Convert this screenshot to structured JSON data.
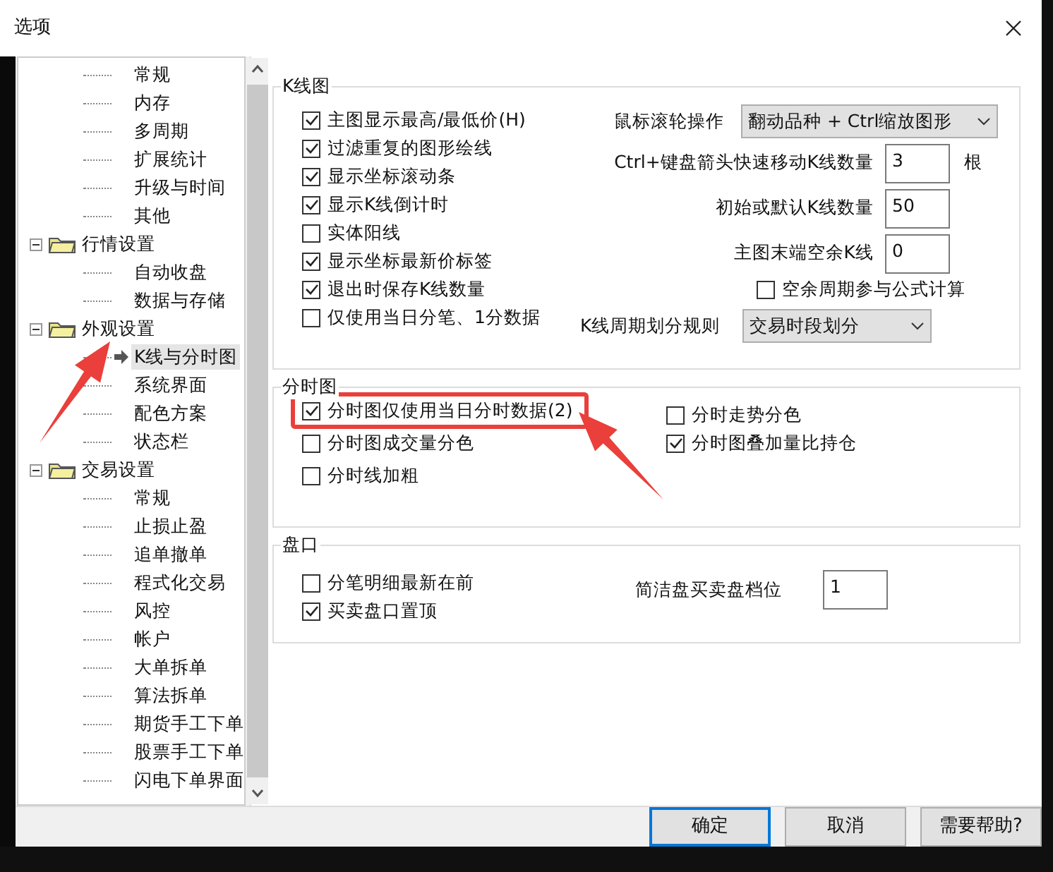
{
  "window": {
    "title": "选项"
  },
  "tree": {
    "partial_children": [
      {
        "label": "常规",
        "selected": false
      },
      {
        "label": "内存",
        "selected": false
      },
      {
        "label": "多周期",
        "selected": false
      },
      {
        "label": "扩展统计",
        "selected": false
      },
      {
        "label": "升级与时间",
        "selected": false
      },
      {
        "label": "其他",
        "selected": false
      }
    ],
    "groups": [
      {
        "label": "行情设置",
        "expanded": true,
        "children": [
          {
            "label": "自动收盘",
            "selected": false
          },
          {
            "label": "数据与存储",
            "selected": false
          }
        ]
      },
      {
        "label": "外观设置",
        "expanded": true,
        "children": [
          {
            "label": "K线与分时图",
            "selected": true
          },
          {
            "label": "系统界面",
            "selected": false
          },
          {
            "label": "配色方案",
            "selected": false
          },
          {
            "label": "状态栏",
            "selected": false
          }
        ]
      },
      {
        "label": "交易设置",
        "expanded": true,
        "children": [
          {
            "label": "常规",
            "selected": false
          },
          {
            "label": "止损止盈",
            "selected": false
          },
          {
            "label": "追单撤单",
            "selected": false
          },
          {
            "label": "程式化交易",
            "selected": false
          },
          {
            "label": "风控",
            "selected": false
          },
          {
            "label": "帐户",
            "selected": false
          },
          {
            "label": "大单拆单",
            "selected": false
          },
          {
            "label": "算法拆单",
            "selected": false
          },
          {
            "label": "期货手工下单",
            "selected": false
          },
          {
            "label": "股票手工下单",
            "selected": false
          },
          {
            "label": "闪电下单界面",
            "selected": false
          }
        ]
      }
    ]
  },
  "kline": {
    "title": "K线图",
    "checkboxes": [
      {
        "label": "主图显示最高/最低价(H)",
        "checked": true
      },
      {
        "label": "过滤重复的图形绘线",
        "checked": true
      },
      {
        "label": "显示坐标滚动条",
        "checked": true
      },
      {
        "label": "显示K线倒计时",
        "checked": true
      },
      {
        "label": "实体阳线",
        "checked": false
      },
      {
        "label": "显示坐标最新价标签",
        "checked": true
      },
      {
        "label": "退出时保存K线数量",
        "checked": true
      },
      {
        "label": "仅使用当日分笔、1分数据",
        "checked": false
      }
    ],
    "wheel": {
      "label": "鼠标滚轮操作",
      "value": "翻动品种 + Ctrl缩放图形"
    },
    "fields": [
      {
        "label": "Ctrl+键盘箭头快速移动K线数量",
        "value": "3",
        "unit": "根"
      },
      {
        "label": "初始或默认K线数量",
        "value": "50"
      },
      {
        "label": "主图末端空余K线",
        "value": "0"
      }
    ],
    "spare": {
      "label": "空余周期参与公式计算",
      "checked": false
    },
    "period": {
      "label": "K线周期划分规则",
      "value": "交易时段划分"
    }
  },
  "fenshi": {
    "title": "分时图",
    "left_checkboxes": [
      {
        "label": "分时图仅使用当日分时数据(2)",
        "checked": true,
        "highlighted": true
      },
      {
        "label": "分时图成交量分色",
        "checked": false,
        "highlighted": false
      },
      {
        "label": "分时线加粗",
        "checked": false,
        "highlighted": false
      }
    ],
    "right_checkboxes": [
      {
        "label": "分时走势分色",
        "checked": false
      },
      {
        "label": "分时图叠加量比持仓",
        "checked": true
      }
    ]
  },
  "pankou": {
    "title": "盘口",
    "checkboxes": [
      {
        "label": "分笔明细最新在前",
        "checked": false
      },
      {
        "label": "买卖盘口置顶",
        "checked": true
      }
    ],
    "field": {
      "label": "简洁盘买卖盘档位",
      "value": "1"
    }
  },
  "buttons": [
    {
      "label": "确定",
      "default": true
    },
    {
      "label": "取消",
      "default": false
    },
    {
      "label": "需要帮助?",
      "default": false
    }
  ]
}
